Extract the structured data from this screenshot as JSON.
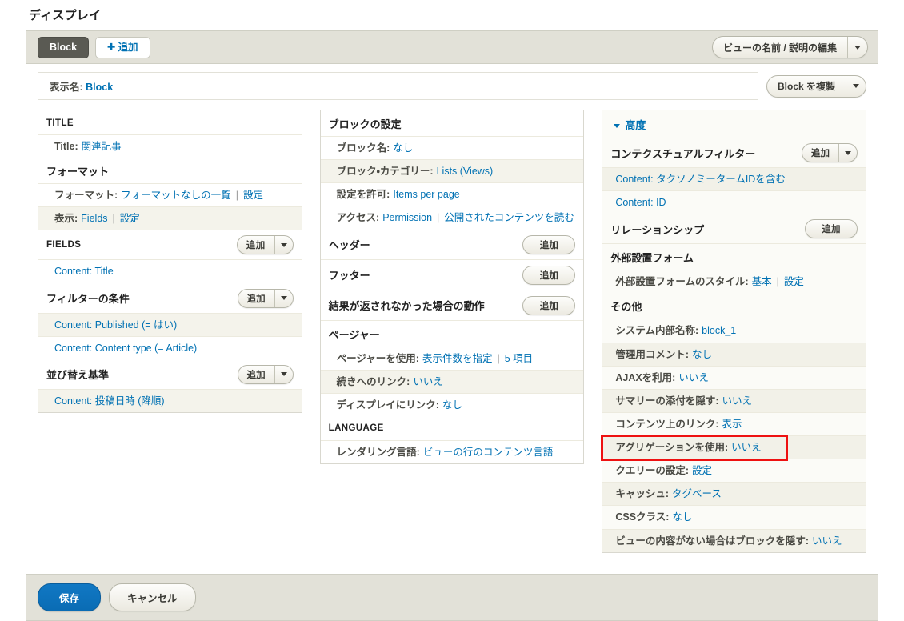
{
  "page": {
    "title": "ディスプレイ"
  },
  "display_tabs": {
    "active_tab": "Block",
    "add_label": "追加",
    "add_icon": "plus-icon",
    "edit_view_name_label": "ビューの名前 / 説明の編集"
  },
  "display_name": {
    "key": "表示名:",
    "value": "Block",
    "duplicate_label": "Block を複製"
  },
  "left_column": {
    "buckets": [
      {
        "title": "TITLE",
        "caps": true,
        "button": null,
        "rows": [
          {
            "alt": false,
            "parts": [
              {
                "t": "k",
                "x": "Title:"
              },
              {
                "t": "v",
                "x": "関連記事"
              }
            ]
          }
        ]
      },
      {
        "title": "フォーマット",
        "caps": false,
        "button": null,
        "rows": [
          {
            "alt": false,
            "parts": [
              {
                "t": "k",
                "x": "フォーマット:"
              },
              {
                "t": "v",
                "x": "フォーマットなしの一覧"
              },
              {
                "t": "sep",
                "x": "|"
              },
              {
                "t": "lnk",
                "x": "設定"
              }
            ]
          },
          {
            "alt": true,
            "parts": [
              {
                "t": "k",
                "x": "表示:"
              },
              {
                "t": "v",
                "x": "Fields"
              },
              {
                "t": "sep",
                "x": "|"
              },
              {
                "t": "lnk",
                "x": "設定"
              }
            ]
          }
        ]
      },
      {
        "title": "FIELDS",
        "caps": true,
        "button": {
          "label": "追加",
          "dropdown": true
        },
        "rows": [
          {
            "alt": false,
            "parts": [
              {
                "t": "lnk",
                "x": "Content: Title"
              }
            ]
          }
        ]
      },
      {
        "title": "フィルターの条件",
        "caps": false,
        "button": {
          "label": "追加",
          "dropdown": true
        },
        "rows": [
          {
            "alt": true,
            "parts": [
              {
                "t": "lnk",
                "x": "Content: Published (= はい)"
              }
            ]
          },
          {
            "alt": false,
            "parts": [
              {
                "t": "lnk",
                "x": "Content: Content type (= Article)"
              }
            ]
          }
        ]
      },
      {
        "title": "並び替え基準",
        "caps": false,
        "button": {
          "label": "追加",
          "dropdown": true
        },
        "rows": [
          {
            "alt": true,
            "parts": [
              {
                "t": "lnk",
                "x": "Content: 投稿日時 (降順)"
              }
            ]
          }
        ]
      }
    ]
  },
  "middle_column": {
    "buckets": [
      {
        "title": "ブロックの設定",
        "caps": false,
        "button": null,
        "rows": [
          {
            "alt": false,
            "parts": [
              {
                "t": "k",
                "x": "ブロック名:"
              },
              {
                "t": "v",
                "x": "なし"
              }
            ]
          },
          {
            "alt": true,
            "parts": [
              {
                "t": "k",
                "x": "ブロック・カテゴリー:"
              },
              {
                "t": "v",
                "x": "Lists (Views)"
              }
            ]
          },
          {
            "alt": false,
            "parts": [
              {
                "t": "k",
                "x": "設定を許可:"
              },
              {
                "t": "v",
                "x": "Items per page"
              }
            ]
          },
          {
            "alt": false,
            "parts": [
              {
                "t": "k",
                "x": "アクセス:"
              },
              {
                "t": "v",
                "x": "Permission"
              },
              {
                "t": "sep",
                "x": "|"
              },
              {
                "t": "lnk",
                "x": "公開されたコンテンツを読む"
              }
            ]
          }
        ]
      },
      {
        "title": "ヘッダー",
        "caps": false,
        "button": {
          "label": "追加",
          "dropdown": false
        },
        "rows": []
      },
      {
        "title": "フッター",
        "caps": false,
        "button": {
          "label": "追加",
          "dropdown": false
        },
        "rows": []
      },
      {
        "title": "結果が返されなかった場合の動作",
        "caps": false,
        "button": {
          "label": "追加",
          "dropdown": false
        },
        "rows": []
      },
      {
        "title": "ページャー",
        "caps": false,
        "button": null,
        "rows": [
          {
            "alt": false,
            "parts": [
              {
                "t": "k",
                "x": "ページャーを使用:"
              },
              {
                "t": "v",
                "x": "表示件数を指定"
              },
              {
                "t": "sep",
                "x": "|"
              },
              {
                "t": "lnk",
                "x": "5 項目"
              }
            ]
          },
          {
            "alt": true,
            "parts": [
              {
                "t": "k",
                "x": "続きへのリンク:"
              },
              {
                "t": "v",
                "x": "いいえ"
              }
            ]
          },
          {
            "alt": false,
            "parts": [
              {
                "t": "k",
                "x": "ディスプレイにリンク:"
              },
              {
                "t": "v",
                "x": "なし"
              }
            ]
          }
        ]
      },
      {
        "title": "LANGUAGE",
        "caps": true,
        "button": null,
        "rows": [
          {
            "alt": false,
            "parts": [
              {
                "t": "k",
                "x": "レンダリング言語:"
              },
              {
                "t": "v",
                "x": "ビューの行のコンテンツ言語"
              }
            ]
          }
        ]
      }
    ]
  },
  "advanced_column": {
    "header_label": "高度",
    "header_icon": "triangle-down-icon",
    "buckets": [
      {
        "title": "コンテクスチュアルフィルター",
        "caps": false,
        "button": {
          "label": "追加",
          "dropdown": true
        },
        "rows": [
          {
            "alt": true,
            "parts": [
              {
                "t": "lnk",
                "x": "Content: タクソノミータームIDを含む"
              }
            ]
          },
          {
            "alt": false,
            "parts": [
              {
                "t": "lnk",
                "x": "Content: ID"
              }
            ]
          }
        ]
      },
      {
        "title": "リレーションシップ",
        "caps": false,
        "button": {
          "label": "追加",
          "dropdown": false
        },
        "rows": []
      },
      {
        "title": "外部設置フォーム",
        "caps": false,
        "button": null,
        "rows": [
          {
            "alt": false,
            "parts": [
              {
                "t": "k",
                "x": "外部設置フォームのスタイル:"
              },
              {
                "t": "v",
                "x": "基本"
              },
              {
                "t": "sep",
                "x": "|"
              },
              {
                "t": "lnk",
                "x": "設定"
              }
            ]
          }
        ]
      },
      {
        "title": "その他",
        "caps": false,
        "button": null,
        "rows": [
          {
            "alt": false,
            "parts": [
              {
                "t": "k",
                "x": "システム内部名称:"
              },
              {
                "t": "v",
                "x": "block_1"
              }
            ]
          },
          {
            "alt": true,
            "parts": [
              {
                "t": "k",
                "x": "管理用コメント:"
              },
              {
                "t": "v",
                "x": "なし"
              }
            ]
          },
          {
            "alt": false,
            "parts": [
              {
                "t": "k",
                "x": "AJAXを利用:"
              },
              {
                "t": "v",
                "x": "いいえ"
              }
            ]
          },
          {
            "alt": true,
            "parts": [
              {
                "t": "k",
                "x": "サマリーの添付を隠す:"
              },
              {
                "t": "v",
                "x": "いいえ"
              }
            ]
          },
          {
            "alt": false,
            "parts": [
              {
                "t": "k",
                "x": "コンテンツ上のリンク:"
              },
              {
                "t": "v",
                "x": "表示"
              }
            ]
          },
          {
            "alt": true,
            "highlight": true,
            "parts": [
              {
                "t": "k",
                "x": "アグリゲーションを使用:"
              },
              {
                "t": "v",
                "x": "いいえ"
              }
            ]
          },
          {
            "alt": false,
            "parts": [
              {
                "t": "k",
                "x": "クエリーの設定:"
              },
              {
                "t": "v",
                "x": "設定"
              }
            ]
          },
          {
            "alt": true,
            "parts": [
              {
                "t": "k",
                "x": "キャッシュ:"
              },
              {
                "t": "v",
                "x": "タグベース"
              }
            ]
          },
          {
            "alt": false,
            "parts": [
              {
                "t": "k",
                "x": "CSSクラス:"
              },
              {
                "t": "v",
                "x": "なし"
              }
            ]
          },
          {
            "alt": true,
            "parts": [
              {
                "t": "k",
                "x": "ビューの内容がない場合はブロックを隠す:"
              },
              {
                "t": "v",
                "x": "いいえ"
              }
            ]
          }
        ]
      }
    ]
  },
  "form_actions": {
    "save_label": "保存",
    "cancel_label": "キャンセル"
  },
  "colors": {
    "link": "#0071b3",
    "highlight": "#ee1111",
    "tab_active_bg": "#5a5a53",
    "chrome_bg": "#e2e1d8",
    "primary_button": "#0a6cb4"
  }
}
